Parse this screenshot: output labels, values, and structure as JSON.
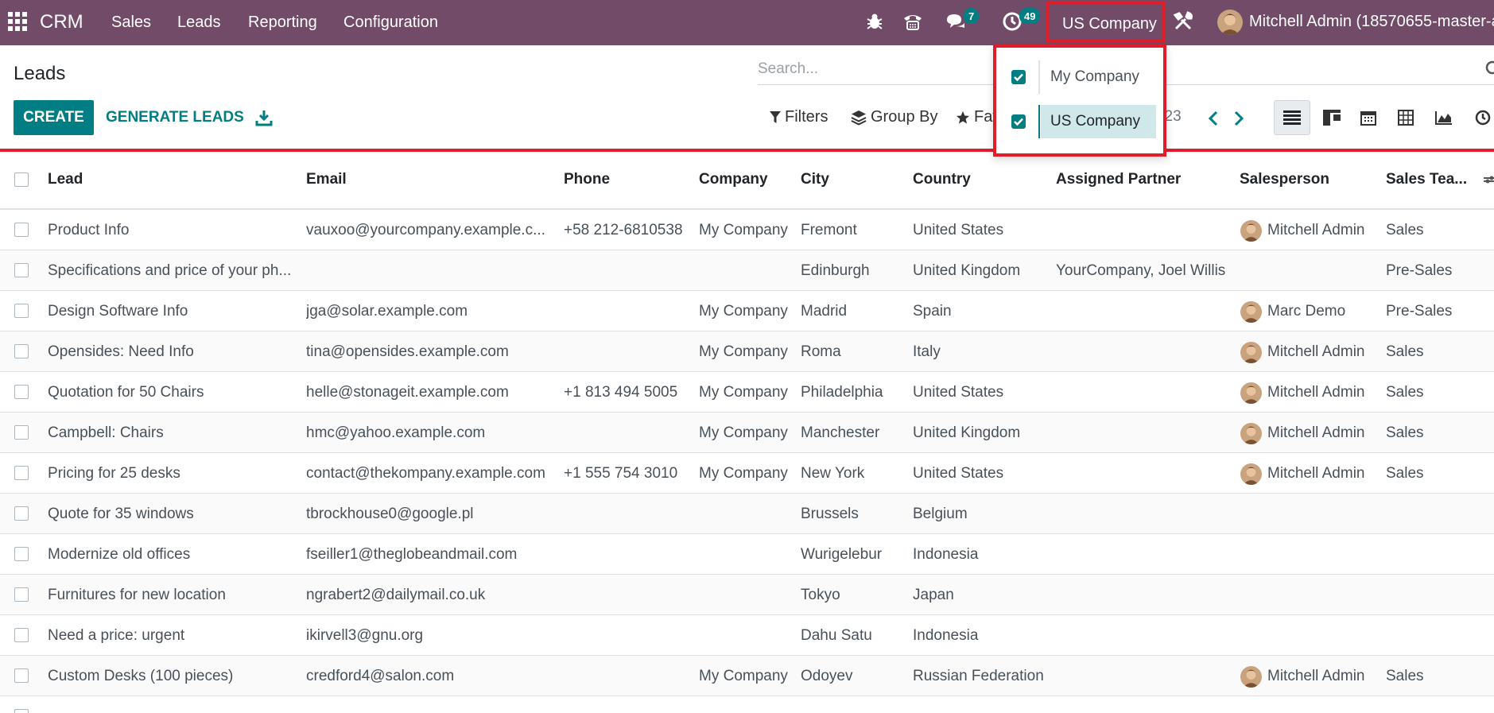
{
  "navbar": {
    "brand": "CRM",
    "menu": [
      "Sales",
      "Leads",
      "Reporting",
      "Configuration"
    ],
    "chat_badge": "7",
    "activity_badge": "49",
    "company": "US Company",
    "user": "Mitchell Admin (18570655-master-a"
  },
  "control_panel": {
    "title": "Leads",
    "create_label": "CREATE",
    "generate_label": "GENERATE LEADS",
    "search_placeholder": "Search...",
    "filters_label": "Filters",
    "groupby_label": "Group By",
    "favorites_label": "Fav",
    "pager": "/ 23"
  },
  "company_dropdown": [
    {
      "label": "My Company",
      "checked": true
    },
    {
      "label": "US Company",
      "checked": true
    }
  ],
  "table": {
    "columns": [
      "Lead",
      "Email",
      "Phone",
      "Company",
      "City",
      "Country",
      "Assigned Partner",
      "Salesperson",
      "Sales Tea..."
    ],
    "rows": [
      {
        "lead": "Product Info",
        "email": "vauxoo@yourcompany.example.c...",
        "phone": "+58 212-6810538",
        "company": "My Company",
        "city": "Fremont",
        "country": "United States",
        "partner": "",
        "salesperson": "Mitchell Admin",
        "team": "Sales"
      },
      {
        "lead": "Specifications and price of your ph...",
        "email": "",
        "phone": "",
        "company": "",
        "city": "Edinburgh",
        "country": "United Kingdom",
        "partner": "YourCompany, Joel Willis",
        "salesperson": "",
        "team": "Pre-Sales"
      },
      {
        "lead": "Design Software Info",
        "email": "jga@solar.example.com",
        "phone": "",
        "company": "My Company",
        "city": "Madrid",
        "country": "Spain",
        "partner": "",
        "salesperson": "Marc Demo",
        "team": "Pre-Sales"
      },
      {
        "lead": "Opensides: Need Info",
        "email": "tina@opensides.example.com",
        "phone": "",
        "company": "My Company",
        "city": "Roma",
        "country": "Italy",
        "partner": "",
        "salesperson": "Mitchell Admin",
        "team": "Sales"
      },
      {
        "lead": "Quotation for 50 Chairs",
        "email": "helle@stonageit.example.com",
        "phone": "+1 813 494 5005",
        "company": "My Company",
        "city": "Philadelphia",
        "country": "United States",
        "partner": "",
        "salesperson": "Mitchell Admin",
        "team": "Sales"
      },
      {
        "lead": "Campbell: Chairs",
        "email": "hmc@yahoo.example.com",
        "phone": "",
        "company": "My Company",
        "city": "Manchester",
        "country": "United Kingdom",
        "partner": "",
        "salesperson": "Mitchell Admin",
        "team": "Sales"
      },
      {
        "lead": "Pricing for 25 desks",
        "email": "contact@thekompany.example.com",
        "phone": "+1 555 754 3010",
        "company": "My Company",
        "city": "New York",
        "country": "United States",
        "partner": "",
        "salesperson": "Mitchell Admin",
        "team": "Sales"
      },
      {
        "lead": "Quote for 35 windows",
        "email": "tbrockhouse0@google.pl",
        "phone": "",
        "company": "",
        "city": "Brussels",
        "country": "Belgium",
        "partner": "",
        "salesperson": "",
        "team": ""
      },
      {
        "lead": "Modernize old offices",
        "email": "fseiller1@theglobeandmail.com",
        "phone": "",
        "company": "",
        "city": "Wurigelebur",
        "country": "Indonesia",
        "partner": "",
        "salesperson": "",
        "team": ""
      },
      {
        "lead": "Furnitures for new location",
        "email": "ngrabert2@dailymail.co.uk",
        "phone": "",
        "company": "",
        "city": "Tokyo",
        "country": "Japan",
        "partner": "",
        "salesperson": "",
        "team": ""
      },
      {
        "lead": "Need a price: urgent",
        "email": "ikirvell3@gnu.org",
        "phone": "",
        "company": "",
        "city": "Dahu Satu",
        "country": "Indonesia",
        "partner": "",
        "salesperson": "",
        "team": ""
      },
      {
        "lead": "Custom Desks (100 pieces)",
        "email": "credford4@salon.com",
        "phone": "",
        "company": "My Company",
        "city": "Odoyev",
        "country": "Russian Federation",
        "partner": "",
        "salesperson": "Mitchell Admin",
        "team": "Sales"
      },
      {
        "lead": "",
        "email": "",
        "phone": "",
        "company": "",
        "city": "",
        "country": "",
        "partner": "",
        "salesperson": "",
        "team": ""
      }
    ]
  }
}
